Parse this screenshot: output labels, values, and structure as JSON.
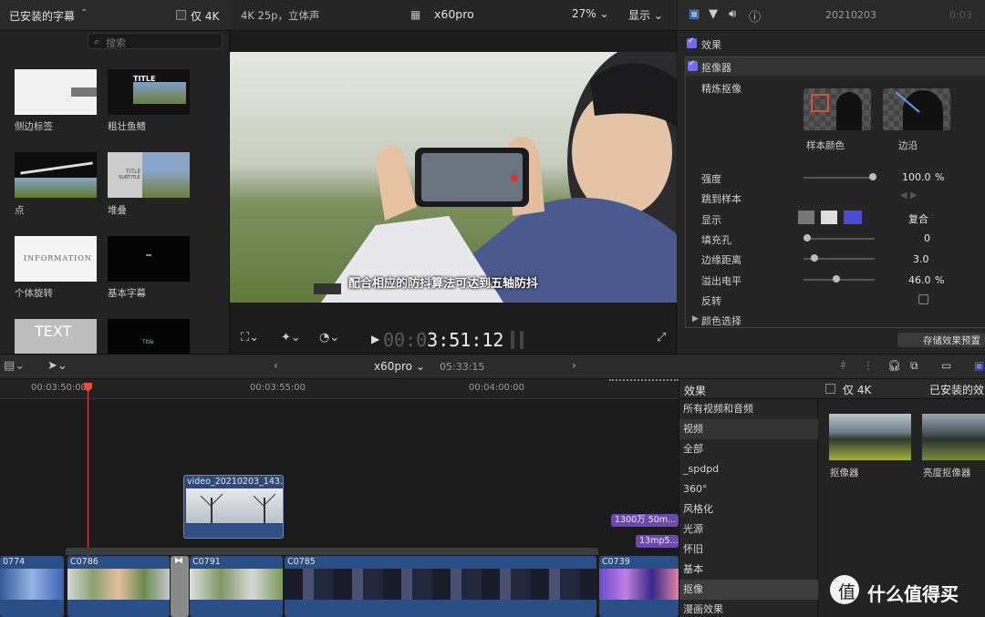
{
  "browser": {
    "title": "已安装的字幕",
    "only_4k": "仅 4K",
    "search_placeholder": "搜索",
    "items": [
      {
        "label": "侧边标签"
      },
      {
        "label": "粗壮鱼鳍"
      },
      {
        "label": "点"
      },
      {
        "label": "堆叠"
      },
      {
        "label": "个体旋转"
      },
      {
        "label": "基本字幕"
      }
    ],
    "thumb_texts": {
      "title": "TITLE",
      "title2": "TITLE",
      "subtitle": "SUBTITLE",
      "information": "INFORMATION",
      "text": "TEXT",
      "title_small": "Title"
    }
  },
  "viewer": {
    "format": "4K 25p，立体声",
    "project": "x60pro",
    "zoom": "27%",
    "display": "显示",
    "subtitle": "配合相应的防抖算法可达到五轴防抖",
    "timecode_dim": "00:0",
    "timecode_bright": "3:51:12"
  },
  "inspector": {
    "date": "20210203",
    "tc": "0:03",
    "effects_label": "效果",
    "keyer_label": "抠像器",
    "refine_key": "精炼抠像",
    "sample_color": "样本颜色",
    "edges": "边沿",
    "params": [
      {
        "label": "强度",
        "value": "100.0",
        "unit": "%",
        "level": 1.0
      },
      {
        "label": "跳到样本",
        "value": "",
        "unit": ""
      },
      {
        "label": "显示",
        "value": "复合",
        "unit": ""
      },
      {
        "label": "填充孔",
        "value": "0",
        "unit": "",
        "level": 0.0
      },
      {
        "label": "边缘距离",
        "value": "3.0",
        "unit": "",
        "level": 0.12
      },
      {
        "label": "溢出电平",
        "value": "46.0",
        "unit": "%",
        "level": 0.46
      },
      {
        "label": "反转",
        "value": "",
        "unit": ""
      },
      {
        "label": "颜色选择",
        "value": "",
        "unit": ""
      }
    ],
    "save_preset": "存储效果预置"
  },
  "timeline": {
    "project": "x60pro",
    "duration": "05:33:15",
    "ruler": [
      "00:03:50:00",
      "00:03:55:00",
      "00:04:00:00"
    ],
    "connected_clip": "video_20210203_143...",
    "purple_1": "1300万 50m...",
    "purple_2": "13mp5...",
    "clips": [
      "0774",
      "C0786",
      "C0791",
      "C0785",
      "C0739"
    ]
  },
  "effects": {
    "title": "效果",
    "only_4k": "仅 4K",
    "installed": "已安装的效",
    "categories": [
      "所有视频和音频",
      "视频",
      "全部",
      "_spdpd",
      "360°",
      "风格化",
      "光源",
      "怀旧",
      "基本",
      "抠像",
      "漫画效果"
    ],
    "selected_category": "抠像",
    "items": [
      {
        "label": "抠像器"
      },
      {
        "label": "亮度抠像器"
      }
    ]
  },
  "watermark": "什么值得买"
}
